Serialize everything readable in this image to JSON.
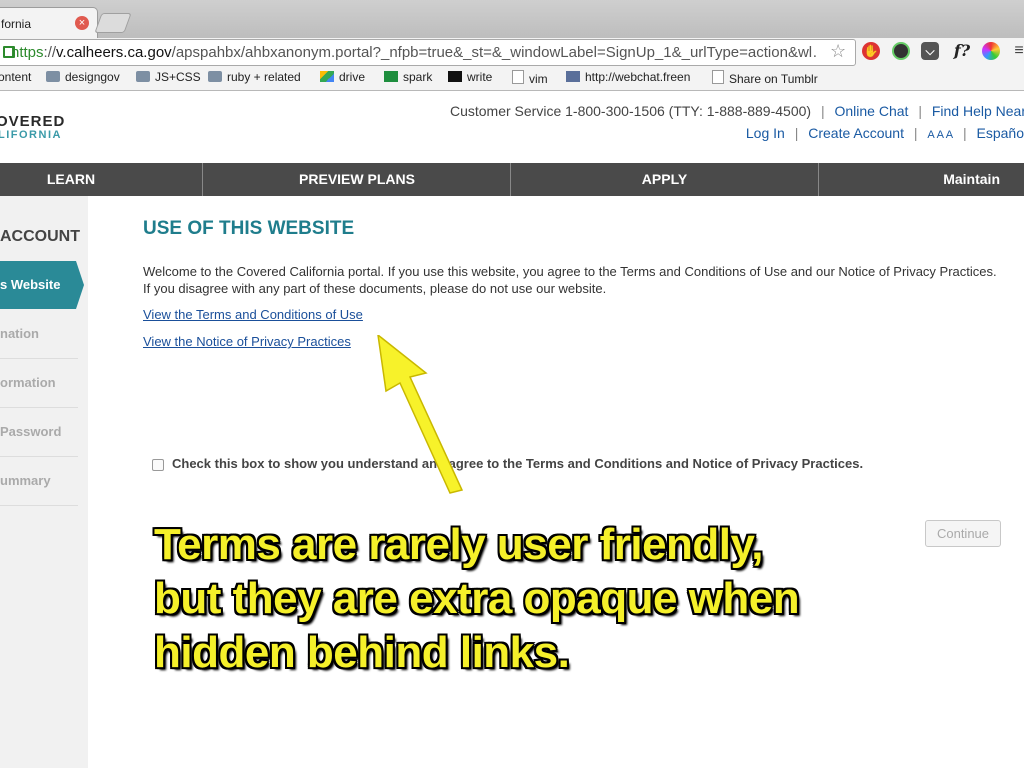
{
  "browser": {
    "tab_title": "fornia",
    "tab_close_glyph": "×",
    "url_scheme": "https",
    "url_sep": "://",
    "url_host": "v.calheers.ca.gov",
    "url_path": "/apspahbx/ahbxanonym.portal?_nfpb=true&_st=&_windowLabel=SignUp_1&_urlType=action&wl…",
    "bookmarks": [
      {
        "label": "ontent",
        "icon": "none"
      },
      {
        "label": "designgov",
        "icon": "folder-icon"
      },
      {
        "label": "JS+CSS",
        "icon": "folder-icon"
      },
      {
        "label": "ruby + related",
        "icon": "folder-icon"
      },
      {
        "label": "drive",
        "icon": "drive-icon"
      },
      {
        "label": "spark",
        "icon": "sheet-icon"
      },
      {
        "label": "write",
        "icon": "medium-icon"
      },
      {
        "label": "vim",
        "icon": "page-icon"
      },
      {
        "label": "http://webchat.freen",
        "icon": "webchat-icon"
      },
      {
        "label": "Share on Tumblr",
        "icon": "page-icon"
      }
    ],
    "ext_f_label": "f?"
  },
  "header": {
    "logo_line1": "OVERED",
    "logo_line2": "LIFORNIA",
    "customer_service": "Customer Service 1-800-300-1506 (TTY: 1-888-889-4500)",
    "online_chat": "Online Chat",
    "find_help": "Find Help Near",
    "log_in": "Log In",
    "create_account": "Create Account",
    "text_size": "A A A",
    "espanol": "Españo",
    "separator": "|"
  },
  "nav": {
    "items": [
      "LEARN",
      "PREVIEW PLANS",
      "APPLY",
      "Maintain"
    ]
  },
  "sidebar": {
    "heading": "ACCOUNT",
    "active": "s Website",
    "items": [
      "nation",
      "ormation",
      "Password",
      "ummary"
    ]
  },
  "main": {
    "title": "USE OF THIS WEBSITE",
    "intro": "Welcome to the Covered California portal. If you use this website, you agree to the Terms and Conditions of Use and our Notice of Privacy Practices. If you disagree with any part of these documents, please do not use our website.",
    "link_terms": "View the Terms and Conditions of Use",
    "link_privacy": "View the Notice of Privacy Practices",
    "checkbox_label": "Check this box to show you understand and agree to the Terms and Conditions and Notice of Privacy Practices.",
    "continue_label": "Continue"
  },
  "annotation": {
    "line1": "Terms are rarely user friendly,",
    "line2": "but they are extra opaque when",
    "line3": "hidden behind links.",
    "color": "#f5f02a"
  }
}
